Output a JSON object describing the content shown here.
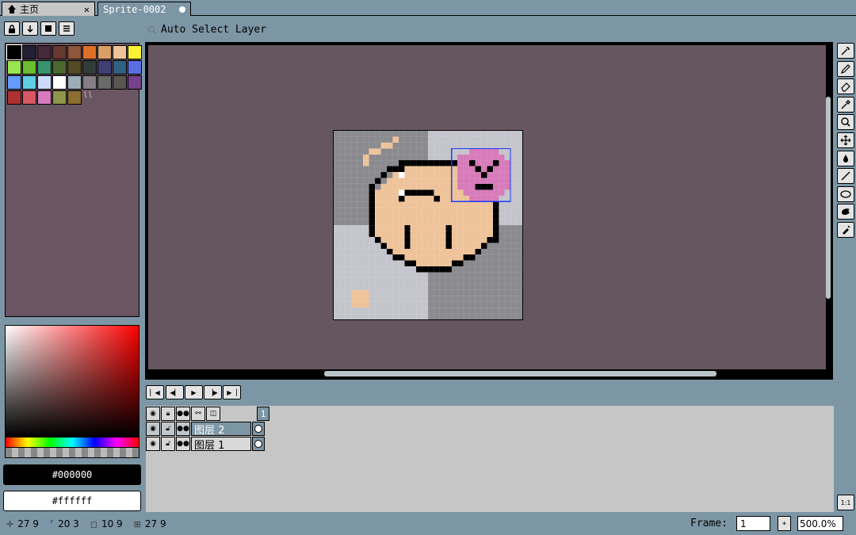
{
  "tabs": [
    {
      "label": "主页",
      "close": "✕"
    },
    {
      "label": "Sprite-0002"
    }
  ],
  "palette_buttons": [
    "lock-icon",
    "arrow-down-icon",
    "save-icon",
    "menu-icon"
  ],
  "palette": {
    "colors": [
      "#000000",
      "#222034",
      "#45283c",
      "#663931",
      "#8f563b",
      "#df7126",
      "#d9a066",
      "#eec39a",
      "#fbf236",
      "#99e550",
      "#6abe30",
      "#37946e",
      "#4b692f",
      "#524b24",
      "#323c39",
      "#3f3f74",
      "#306082",
      "#5b6ee1",
      "#639bff",
      "#5fcde4",
      "#cbdbfc",
      "#ffffff",
      "#9badb7",
      "#847e87",
      "#696a6a",
      "#595652",
      "#76428a",
      "#ac3232",
      "#d95763",
      "#d77bba",
      "#8f974a",
      "#8a6f30"
    ],
    "more": "ll"
  },
  "color_picker": {
    "fg": "#000000",
    "bg": "#ffffff"
  },
  "toolbar": {
    "auto_select_label": "Auto Select Layer"
  },
  "canvas": {
    "background": "#665660",
    "sprite": {
      "width": 32,
      "height": 32,
      "zoom": "500.0%",
      "selection": {
        "x": 20,
        "y": 3,
        "w": 10,
        "h": 9
      }
    }
  },
  "tools": [
    "magic-wand-icon",
    "pencil-icon",
    "eraser-icon",
    "eyedropper-icon",
    "zoom-icon",
    "move-icon",
    "fill-icon",
    "line-icon",
    "ellipse-icon",
    "contour-icon",
    "blur-icon"
  ],
  "timeline": {
    "buttons": [
      "first-frame",
      "previous-frame",
      "play",
      "next-frame",
      "last-frame"
    ],
    "header_frame": "1",
    "layers": [
      {
        "name": "图层 2",
        "selected": true
      },
      {
        "name": "图层 1",
        "selected": false
      }
    ]
  },
  "status": {
    "cursor": "27 9",
    "selection_origin": "20 3",
    "selection_size": "10 9",
    "grid": "27 9"
  },
  "frame": {
    "label": "Frame:",
    "value": "1",
    "zoom": "500.0%"
  }
}
